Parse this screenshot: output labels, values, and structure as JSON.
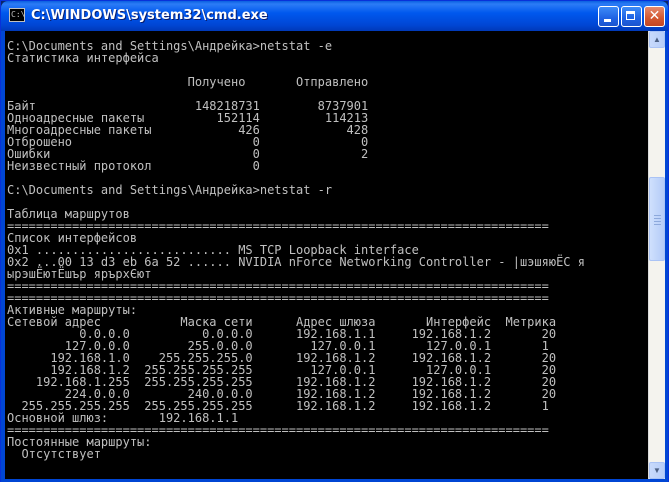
{
  "window": {
    "title": "C:\\WINDOWS\\system32\\cmd.exe",
    "icon": "cmd-icon",
    "icon_text": "C:\\",
    "buttons": {
      "close_label": "✕"
    }
  },
  "console_lines": [
    "C:\\Documents and Settings\\Андрейка>netstat -e",
    "Статистика интерфейса",
    "",
    "                         Получено       Отправлено",
    "",
    "Байт                      148218731        8737901",
    "Одноадресные пакеты          152114         114213",
    "Многоадресные пакеты            426            428",
    "Отброшено                         0              0",
    "Ошибки                            0              2",
    "Неизвестный протокол              0",
    "",
    "C:\\Documents and Settings\\Андрейка>netstat -r",
    "",
    "Таблица маршрутов",
    "===========================================================================",
    "Список интерфейсов",
    "0x1 ........................... MS TCP Loopback interface",
    "0x2 ...00 13 d3 eb 6a 52 ...... NVIDIA nForce Networking Controller - |шэшяюЁС я",
    "ырэшЁютЁшър ярърхЄют",
    "===========================================================================",
    "===========================================================================",
    "Активные маршруты:",
    "Сетевой адрес           Маска сети      Адрес шлюза       Интерфейс  Метрика",
    "          0.0.0.0          0.0.0.0      192.168.1.1     192.168.1.2       20",
    "        127.0.0.0        255.0.0.0        127.0.0.1       127.0.0.1       1",
    "      192.168.1.0    255.255.255.0      192.168.1.2     192.168.1.2       20",
    "      192.168.1.2  255.255.255.255        127.0.0.1       127.0.0.1       20",
    "    192.168.1.255  255.255.255.255      192.168.1.2     192.168.1.2       20",
    "        224.0.0.0        240.0.0.0      192.168.1.2     192.168.1.2       20",
    "  255.255.255.255  255.255.255.255      192.168.1.2     192.168.1.2       1",
    "Основной шлюз:       192.168.1.1",
    "===========================================================================",
    "Постоянные маршруты:",
    "  Отсутствует"
  ],
  "scrollbar": {
    "up_arrow": "▲",
    "down_arrow": "▼",
    "thumb_position": 0.39
  },
  "colors": {
    "console_bg": "#000000",
    "console_fg": "#c0c0c0",
    "titlebar": "#0058ee"
  }
}
